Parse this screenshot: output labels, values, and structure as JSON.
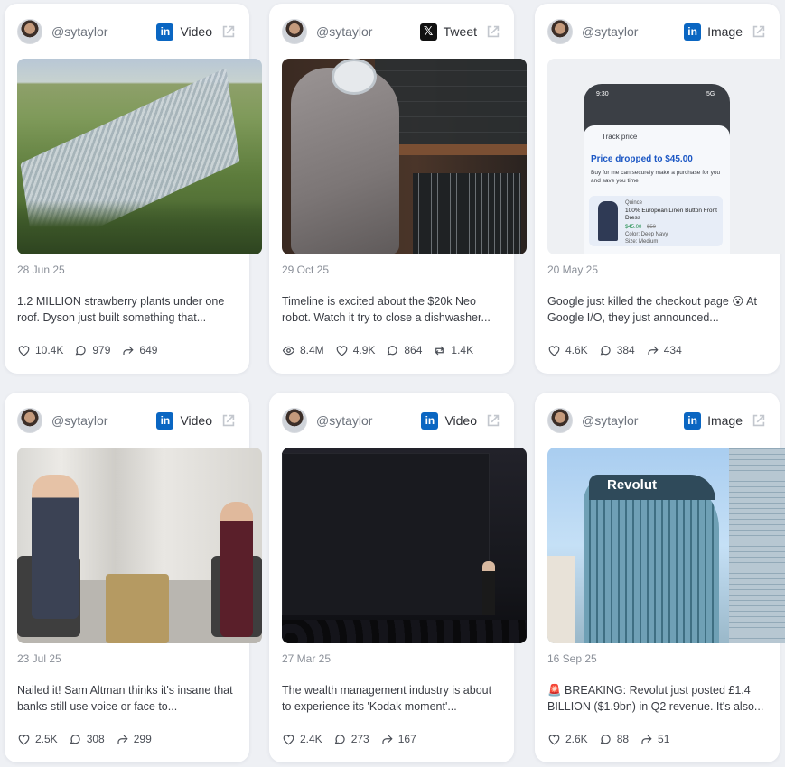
{
  "cards": [
    {
      "handle": "@sytaylor",
      "platform": "Video",
      "platform_icon": "linkedin-icon",
      "date": "28 Jun 25",
      "text": "1.2 MILLION strawberry plants under one roof. Dyson just built something that...",
      "stats": {
        "likes": "10.4K",
        "comments": "979",
        "shares": "649"
      }
    },
    {
      "handle": "@sytaylor",
      "platform": "Tweet",
      "platform_icon": "x-icon",
      "date": "29 Oct 25",
      "text": "Timeline is excited about the $20k Neo robot. Watch it try to close a dishwasher...",
      "stats": {
        "views": "8.4M",
        "likes": "4.9K",
        "comments": "864",
        "reposts": "1.4K"
      }
    },
    {
      "handle": "@sytaylor",
      "platform": "Image",
      "platform_icon": "linkedin-icon",
      "date": "20 May 25",
      "text": "Google just killed the checkout page 😮 At Google I/O, they just announced...",
      "stats": {
        "likes": "4.6K",
        "comments": "384",
        "shares": "434"
      },
      "image_text": {
        "time": "9:30",
        "status": "5G",
        "track": "Track price",
        "headline": "Price dropped to $45.00",
        "sub": "Buy for me can securely make a purchase for you and save you time",
        "brand": "Quince",
        "product": "100% European Linen Button Front Dress",
        "price_new": "$45.00",
        "price_old": "$50",
        "color": "Color: Deep Navy",
        "size": "Size: Medium"
      }
    },
    {
      "handle": "@sytaylor",
      "platform": "Video",
      "platform_icon": "linkedin-icon",
      "date": "23 Jul 25",
      "text": "Nailed it! Sam Altman thinks it's insane that banks still use voice or face to...",
      "stats": {
        "likes": "2.5K",
        "comments": "308",
        "shares": "299"
      }
    },
    {
      "handle": "@sytaylor",
      "platform": "Video",
      "platform_icon": "linkedin-icon",
      "date": "27 Mar 25",
      "text": "The wealth management industry is about to experience its 'Kodak moment'...",
      "stats": {
        "likes": "2.4K",
        "comments": "273",
        "shares": "167"
      }
    },
    {
      "handle": "@sytaylor",
      "platform": "Image",
      "platform_icon": "linkedin-icon",
      "date": "16 Sep 25",
      "text": "🚨 BREAKING: Revolut just posted £1.4 BILLION ($1.9bn) in Q2 revenue. It's also...",
      "stats": {
        "likes": "2.6K",
        "comments": "88",
        "shares": "51"
      },
      "image_text": {
        "sign": "Revolut"
      }
    }
  ],
  "colors": {
    "background": "#eef0f4",
    "card": "#ffffff",
    "linkedin": "#0a66c2",
    "x": "#111111",
    "muted": "#8a8f98"
  }
}
